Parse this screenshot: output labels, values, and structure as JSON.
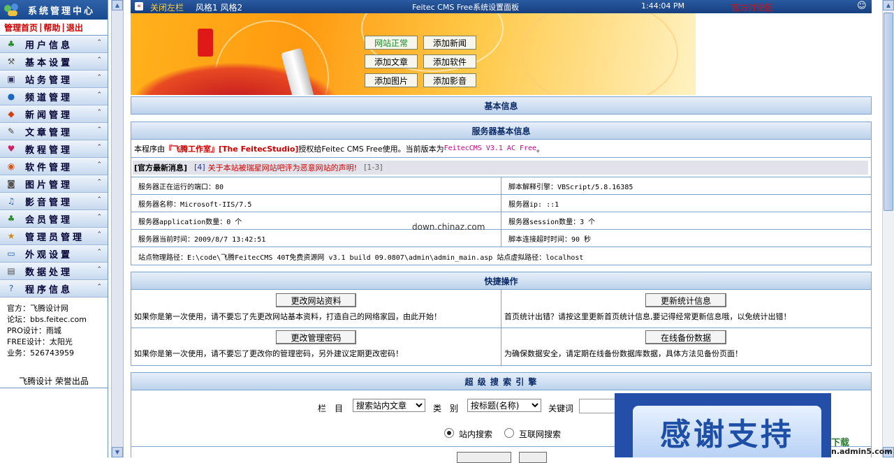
{
  "sidebar": {
    "title": "系统管理中心",
    "links": [
      "管理首页",
      "帮助",
      "退出"
    ],
    "menu": [
      {
        "label": "用户信息",
        "icon": "users-icon",
        "color": "#2a8a2a"
      },
      {
        "label": "基本设置",
        "icon": "tools-icon",
        "color": "#555555"
      },
      {
        "label": "站务管理",
        "icon": "monitor-icon",
        "color": "#333366"
      },
      {
        "label": "频道管理",
        "icon": "globe-icon",
        "color": "#1f66c0"
      },
      {
        "label": "新闻管理",
        "icon": "windows-icon",
        "color": "#d04010"
      },
      {
        "label": "文章管理",
        "icon": "pen-icon",
        "color": "#444444"
      },
      {
        "label": "教程管理",
        "icon": "heart-icon",
        "color": "#d02060"
      },
      {
        "label": "软件管理",
        "icon": "disc-icon",
        "color": "#e05010"
      },
      {
        "label": "图片管理",
        "icon": "camera-icon",
        "color": "#555555"
      },
      {
        "label": "影音管理",
        "icon": "music-icon",
        "color": "#3060c0"
      },
      {
        "label": "会员管理",
        "icon": "member-icon",
        "color": "#2a8a2a"
      },
      {
        "label": "管理员管理",
        "icon": "admin-icon",
        "color": "#d08a10"
      },
      {
        "label": "外观设置",
        "icon": "display-icon",
        "color": "#1f5fb0"
      },
      {
        "label": "数据处理",
        "icon": "database-icon",
        "color": "#505050"
      },
      {
        "label": "程序信息",
        "icon": "help-icon",
        "color": "#1f5fb0"
      }
    ],
    "info": [
      "官方：飞腾设计网",
      "论坛：bbs.feitec.com",
      "PRO设计：雨城",
      "FREE设计：太阳光",
      "业务：526743959"
    ],
    "footer": "飞腾设计 荣誉出品"
  },
  "topbar": {
    "close": "关闭左栏",
    "styles": "风格1 风格2",
    "title": "Feitec CMS Free系统设置面板",
    "time": "1:44:04 PM",
    "forum": "官方讨论区"
  },
  "quick_buttons": [
    "网站正常",
    "添加新闻",
    "添加文章",
    "添加软件",
    "添加图片",
    "添加影音"
  ],
  "basic_info": {
    "title": "基本信息"
  },
  "server": {
    "title": "服务器基本信息",
    "license_prefix": "本程序由",
    "license_author": "『飞腾工作室』[The FeitecStudio]",
    "license_mid": "授权给Feitec CMS Free使用。当前版本为",
    "license_version": "FeitecCMS V3.1 AC Free",
    "license_end": "。",
    "news_label": "[官方最新消息]",
    "news_num": "[4]",
    "news_text": "关于本站被瑞星网站吧评为恶意网站的声明!",
    "news_range": "[1-3]",
    "rows": [
      [
        "服务器正在运行的端口：80",
        "脚本解释引擎：VBScript/5.8.16385"
      ],
      [
        "服务器名称：Microsoft-IIS/7.5",
        "服务器ip: ::1"
      ],
      [
        "服务器application数量：0 个",
        "服务器session数量：3 个"
      ],
      [
        "服务器当前时间：2009/8/7 13:42:51",
        "脚本连接超时时间：90 秒"
      ]
    ],
    "path": "站点物理路径：E:\\code\\飞腾FeitecCMS 40T免费资源网 v3.1 build 09.0807\\admin\\admin_main.asp 站点虚拟路径：localhost"
  },
  "quick_ops": {
    "title": "快捷操作",
    "items": [
      {
        "button": "更改网站资料",
        "desc": "如果你是第一次使用，请不要忘了先更改网站基本资料，打造自己的网络家园，由此开始！"
      },
      {
        "button": "更新统计信息",
        "desc": "首页统计出错？请按这里更新首页统计信息,要记得经常更新信息哦，以免统计出错！"
      },
      {
        "button": "更改管理密码",
        "desc": "如果你是第一次使用，请不要忘了更改你的管理密码，另外建议定期更改密码！"
      },
      {
        "button": "在线备份数据",
        "desc": "为确保数据安全，请定期在线备份数据库数据，具体方法见备份页面！"
      }
    ]
  },
  "search": {
    "title": "超 级 搜 索 引 擎",
    "column_label": "栏　目",
    "column_value": "搜索站内文章",
    "type_label": "类　别",
    "type_value": "按标题(名称)",
    "keyword_label": "关键词",
    "radio_site": "站内搜索",
    "radio_web": "互联网搜索"
  },
  "watermark": "down.chinaz.com",
  "ad": {
    "text": "感谢支持",
    "site_tail": "下载",
    "url_tail": "n.admin5.com"
  }
}
